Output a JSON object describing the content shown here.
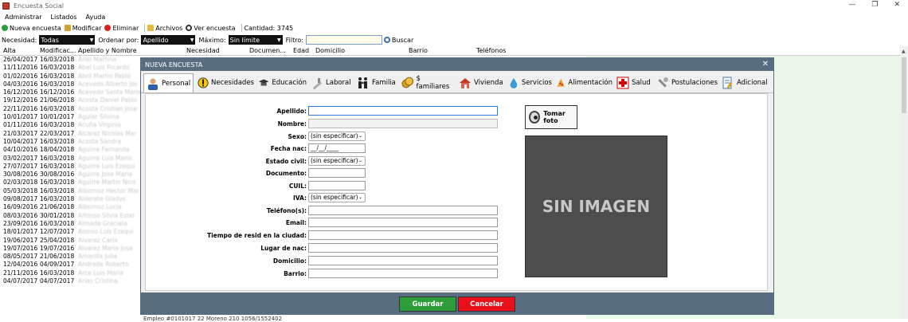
{
  "window": {
    "title": "Encuesta Social",
    "min": "—",
    "max": "❐",
    "close": "✕"
  },
  "menu": [
    "Administrar",
    "Listados",
    "Ayuda"
  ],
  "toolbar": {
    "new": "Nueva encuesta",
    "edit": "Modificar",
    "delete": "Eliminar",
    "files": "Archivos",
    "view": "Ver encuesta",
    "count_label": "Cantidad: 3745"
  },
  "filters": {
    "need_label": "Necesidad:",
    "need_value": "Todas",
    "order_label": "Ordenar por:",
    "order_value": "Apellido",
    "max_label": "Máximo:",
    "max_value": "Sin límite",
    "filter_label": "Filtro:",
    "search_label": "Buscar"
  },
  "grid": {
    "headers": [
      "Alta",
      "Modificac...",
      "Apellido y Nombre",
      "Necesidad",
      "Documen...",
      "Edad",
      "Domicilio",
      "Barrio",
      "Teléfonos"
    ],
    "rows": [
      [
        "26/04/2017",
        "16/03/2018"
      ],
      [
        "11/11/2016",
        "16/03/2018"
      ],
      [
        "01/02/2016",
        "16/03/2018"
      ],
      [
        "04/03/2016",
        "16/03/2018"
      ],
      [
        "16/12/2016",
        "16/12/2016"
      ],
      [
        "19/12/2016",
        "21/06/2018"
      ],
      [
        "22/11/2016",
        "16/03/2018"
      ],
      [
        "10/01/2017",
        "10/01/2017"
      ],
      [
        "01/11/2016",
        "16/03/2018"
      ],
      [
        "21/03/2017",
        "22/03/2017"
      ],
      [
        "10/04/2017",
        "16/03/2018"
      ],
      [
        "04/10/2016",
        "18/04/2018"
      ],
      [
        "03/02/2017",
        "16/03/2018"
      ],
      [
        "27/07/2017",
        "16/03/2018"
      ],
      [
        "30/08/2016",
        "30/08/2016"
      ],
      [
        "02/03/2018",
        "16/03/2018"
      ],
      [
        "05/03/2018",
        "16/03/2018"
      ],
      [
        "09/08/2017",
        "16/03/2018"
      ],
      [
        "16/09/2016",
        "21/06/2018"
      ],
      [
        "08/03/2016",
        "30/01/2018"
      ],
      [
        "23/09/2016",
        "16/03/2018"
      ],
      [
        "18/01/2017",
        "12/07/2017"
      ],
      [
        "19/06/2017",
        "25/04/2018"
      ],
      [
        "19/07/2016",
        "19/07/2016"
      ],
      [
        "08/05/2017",
        "21/06/2018"
      ],
      [
        "12/04/2016",
        "04/09/2017"
      ],
      [
        "21/11/2016",
        "16/03/2018"
      ],
      [
        "04/07/2017",
        "04/07/2017"
      ]
    ],
    "names": [
      "Ariel Martina",
      "Abel Luis Ricardo",
      "Abril Martin Pablo",
      "Acevedo Alberto Jos",
      "Acevedo Santa Maria",
      "Acosta Daniel Pablo",
      "Acosta Cristian Jose",
      "Aguiar Silvina",
      "Acuña Virginia",
      "Alcaraz Nicolas Mar",
      "Acosta Sandra",
      "Aguirre Fernanda",
      "Aguirre Luis Mario",
      "Aguirre Luis Ezequi",
      "Aguirre Jose Maria",
      "Aguirre Martin Nico",
      "Albornoz Hector Mar",
      "Alderete Gladys",
      "Albornoz Lucia",
      "Alfonso Silvia Estel",
      "Almada Graciela",
      "Alonso Luis Ezequi",
      "Alvarez Carla",
      "Alvarez Maria Jose",
      "Amarilla Julia",
      "Andrade Roberto",
      "Arce Luis Maria",
      "Arias Cristina"
    ],
    "bottom_partial": "Empleo        #0101017      22   Moreno 210                                    1056/1552402"
  },
  "modal": {
    "title": "NUEVA ENCUESTA",
    "close": "✕",
    "tabs": [
      "Personal",
      "Necesidades",
      "Educación",
      "Laboral",
      "Familia",
      "$ familiares",
      "Vivienda",
      "Servicios",
      "Alimentación",
      "Salud",
      "Postulaciones",
      "Adicional"
    ],
    "labels": {
      "apellido": "Apellido:",
      "nombre": "Nombre:",
      "sexo": "Sexo:",
      "fecha_nac": "Fecha nac:",
      "estado_civil": "Estado civil:",
      "documento": "Documento:",
      "cuil": "CUIL:",
      "iva": "IVA:",
      "telefonos": "Teléfono(s):",
      "email": "Email:",
      "tiempo": "Tiempo de resid en la ciudad:",
      "lugar_nac": "Lugar de nac:",
      "domicilio": "Domicilio:",
      "barrio": "Barrio:"
    },
    "values": {
      "sexo": "(sin especificar)",
      "fecha_nac": "__/__/____",
      "estado_civil": "(sin especificar)",
      "iva": "(sin especificar)"
    },
    "photo_button": "Tomar foto",
    "photo_placeholder": "SIN IMAGEN",
    "save": "Guardar",
    "cancel": "Cancelar"
  },
  "colors": {
    "accent": "#596d80",
    "save": "#2e9e3a",
    "cancel": "#e8101a",
    "grid_bg": "#eaf8e7"
  }
}
